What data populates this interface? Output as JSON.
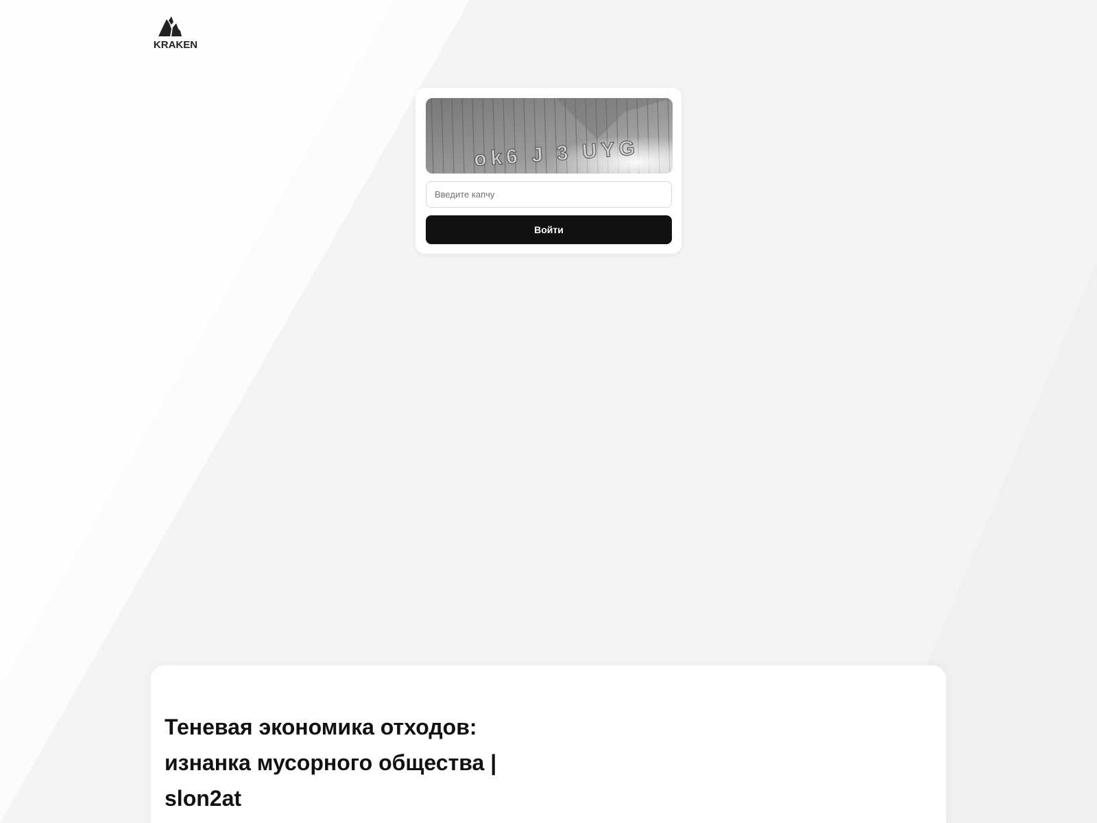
{
  "brand": {
    "name": "KRAKEN",
    "logo_icon": "kraken-mountain-logo"
  },
  "captcha": {
    "image_icon": "captcha-distorted-text-image",
    "image_text": "ok6 J 3 UYG",
    "input_placeholder": "Введите капчу",
    "input_value": "",
    "submit_label": "Войти"
  },
  "article": {
    "title_line_1": "Теневая экономика отходов:",
    "title_line_2": "изнанка мусорного общества |",
    "title_line_3": "slon2at"
  },
  "colors": {
    "page_background": "#f4f4f4",
    "card_background": "#ffffff",
    "button_background": "#121212",
    "button_text": "#ffffff",
    "title_text": "#111111"
  }
}
